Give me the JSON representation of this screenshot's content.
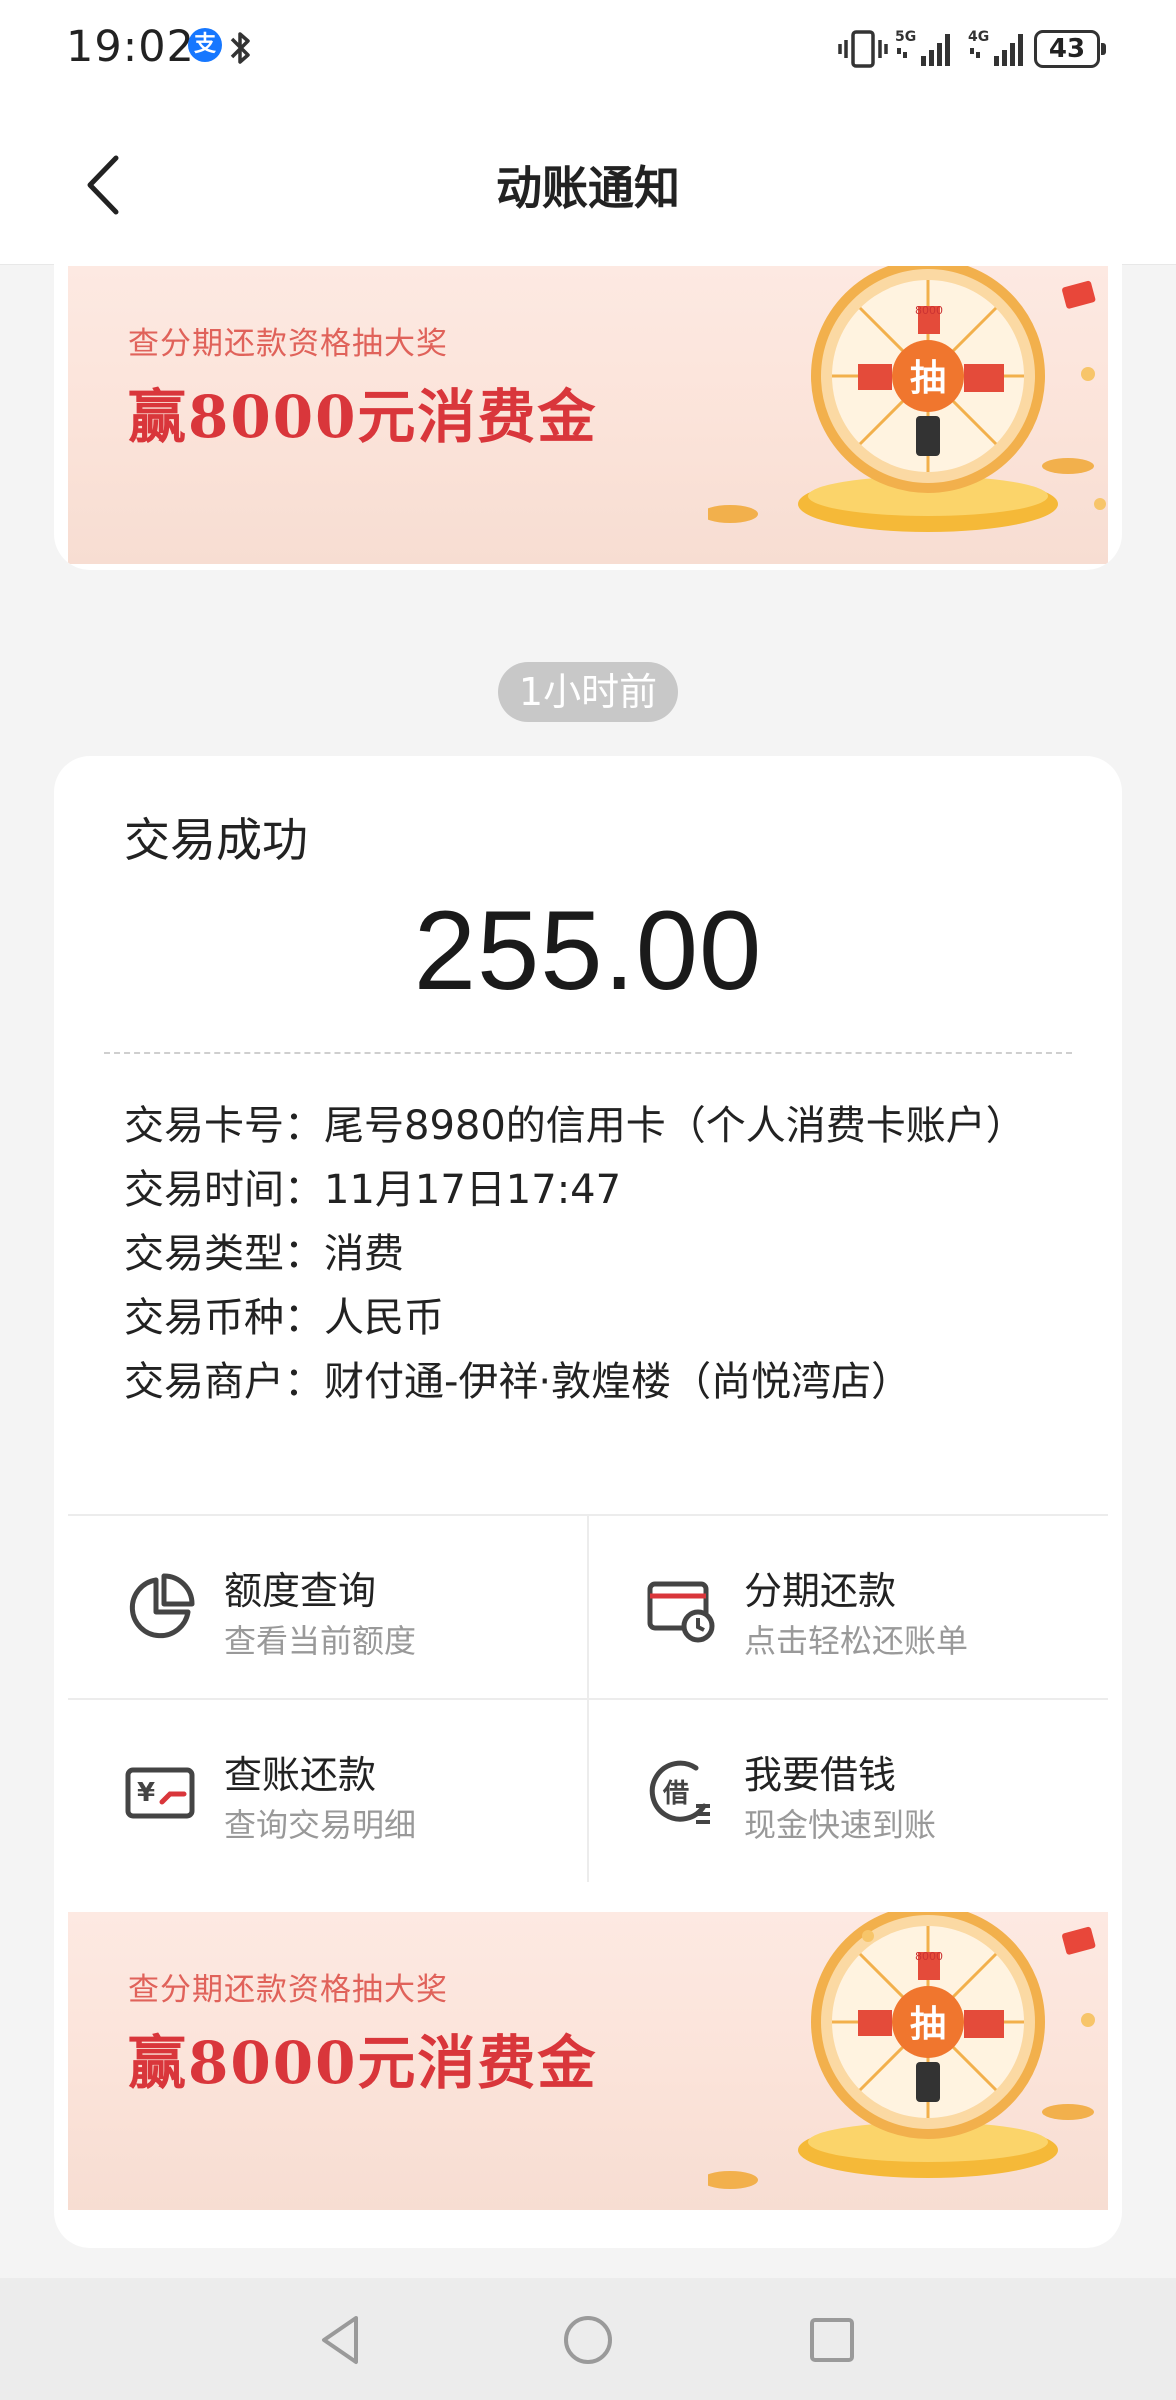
{
  "status_bar": {
    "time": "19:02",
    "battery": "43",
    "icons": [
      "alipay-icon",
      "bluetooth-icon",
      "vibrate-icon",
      "signal-5g-icon",
      "signal-4g-icon",
      "battery-icon"
    ],
    "net1": "5G",
    "net2": "4G"
  },
  "header": {
    "title": "动账通知",
    "back_icon": "chevron-left-icon"
  },
  "banner": {
    "subtitle": "查分期还款资格抽大奖",
    "title": "赢8000元消费金",
    "wheel_label": "抽",
    "prize_label": "8000"
  },
  "time_chip": "1小时前",
  "transaction": {
    "status": "交易成功",
    "amount": "255.00",
    "details": [
      {
        "label": "交易卡号：",
        "value": "尾号8980的信用卡（个人消费卡账户）"
      },
      {
        "label": "交易时间：",
        "value": "11月17日17:47"
      },
      {
        "label": "交易类型：",
        "value": "消费"
      },
      {
        "label": "交易币种：",
        "value": "人民币"
      },
      {
        "label": "交易商户：",
        "value": "财付通-伊祥·敦煌楼（尚悦湾店）"
      }
    ]
  },
  "actions": [
    {
      "title": "额度查询",
      "subtitle": "查看当前额度",
      "icon": "pie-chart-icon"
    },
    {
      "title": "分期还款",
      "subtitle": "点击轻松还账单",
      "icon": "card-clock-icon"
    },
    {
      "title": "查账还款",
      "subtitle": "查询交易明细",
      "icon": "yuan-card-icon"
    },
    {
      "title": "我要借钱",
      "subtitle": "现金快速到账",
      "icon": "borrow-icon"
    }
  ],
  "actions_icon_text": {
    "borrow": "借",
    "yuan": "¥"
  },
  "colors": {
    "accent": "#d9363b",
    "banner_bg": "#fbe3d9",
    "muted": "#999999",
    "chip": "#c8c8c8"
  }
}
